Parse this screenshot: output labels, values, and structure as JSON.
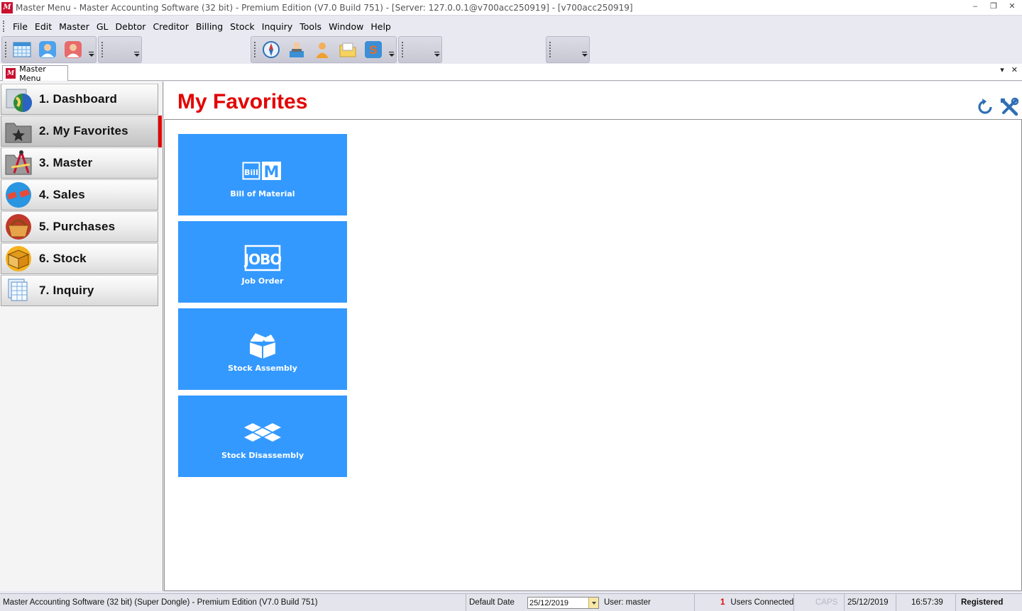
{
  "window": {
    "title": "Master Menu - Master Accounting Software (32 bit) - Premium Edition (V7.0 Build 751) - [Server: 127.0.0.1@v700acc250919] - [v700acc250919]",
    "logo_text": "M",
    "controls": [
      "‒",
      "❐",
      "✕"
    ]
  },
  "menu": [
    "File",
    "Edit",
    "Master",
    "GL",
    "Debtor",
    "Creditor",
    "Billing",
    "Stock",
    "Inquiry",
    "Tools",
    "Window",
    "Help"
  ],
  "toolbar": {
    "group1_icons": [
      "calendar-grid-icon",
      "user-blue-icon",
      "user-red-icon"
    ],
    "group2_icons": [
      "compass-icon",
      "inbox-stamp-icon",
      "person-icon",
      "folder-icon",
      "letter-s-icon"
    ]
  },
  "document_tab": {
    "label": "Master Menu",
    "controls": [
      "▾",
      "✕"
    ]
  },
  "sidebar": {
    "items": [
      {
        "label": "1. Dashboard",
        "icon": "dashboard-globe-icon"
      },
      {
        "label": "2. My Favorites",
        "icon": "favorites-star-folder-icon"
      },
      {
        "label": "3. Master",
        "icon": "master-compass-folder-icon"
      },
      {
        "label": "4. Sales",
        "icon": "sales-tags-icon"
      },
      {
        "label": "5. Purchases",
        "icon": "purchases-basket-icon"
      },
      {
        "label": "6. Stock",
        "icon": "stock-box-icon"
      },
      {
        "label": "7. Inquiry",
        "icon": "inquiry-sheets-icon"
      }
    ],
    "active_index": 1
  },
  "main": {
    "title": "My Favorites",
    "refresh_icon": "refresh-icon",
    "settings_icon": "tools-icon",
    "tiles": [
      {
        "label": "Bill of Material",
        "icon_text_a": "Bill",
        "icon_text_b": "M"
      },
      {
        "label": "Job Order",
        "icon_text": "JOBO"
      },
      {
        "label": "Stock Assembly",
        "icon": "open-box-icon"
      },
      {
        "label": "Stock Disassembly",
        "icon": "scattered-boxes-icon"
      }
    ]
  },
  "status": {
    "product": "Master Accounting Software (32 bit) (Super Dongle) - Premium Edition (V7.0 Build 751)",
    "default_date_label": "Default Date",
    "default_date_value": "25/12/2019",
    "user": "User: master",
    "users_count": "1",
    "users_label": "Users Connected",
    "caps": "CAPS",
    "date": "25/12/2019",
    "time": "16:57:39",
    "registration": "Registered"
  },
  "colors": {
    "accent_red": "#e30000",
    "tile_blue": "#3399ff",
    "logo_red": "#c8102e"
  }
}
